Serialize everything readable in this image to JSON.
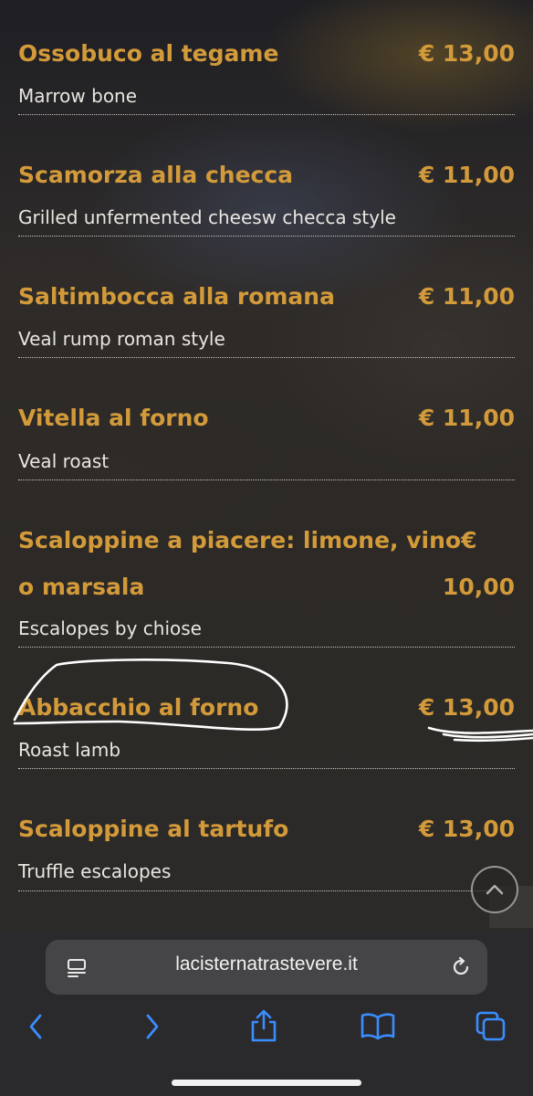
{
  "menu": {
    "items": [
      {
        "name": "Ossobuco al tegame",
        "price": "€ 13,00",
        "desc": "Marrow bone"
      },
      {
        "name": "Scamorza alla checca",
        "price": "€ 11,00",
        "desc": "Grilled unfermented cheesw checca style"
      },
      {
        "name": "Saltimbocca alla romana",
        "price": "€ 11,00",
        "desc": "Veal rump roman style"
      },
      {
        "name": "Vitella al forno",
        "price": "€ 11,00",
        "desc": "Veal roast"
      },
      {
        "name_line1": "Scaloppine a piacere: limone, vino",
        "price_line1": "€",
        "name_line2": "o marsala",
        "price_line2": "10,00",
        "desc": "Escalopes by chiose"
      },
      {
        "name": "Abbacchio al forno",
        "price": "€ 13,00",
        "desc": "Roast lamb"
      },
      {
        "name": "Scaloppine al tartufo",
        "price": "€ 13,00",
        "desc": "Truffle escalopes"
      }
    ]
  },
  "browser": {
    "url": "lacisternatrastevere.it",
    "icons": [
      "reader-icon",
      "reload-icon",
      "back-icon",
      "forward-icon",
      "share-icon",
      "bookmarks-icon",
      "tabs-icon"
    ]
  },
  "colors": {
    "accent": "#d39a3a",
    "text": "#e9e6e0",
    "ios_blue": "#3a8dff"
  }
}
